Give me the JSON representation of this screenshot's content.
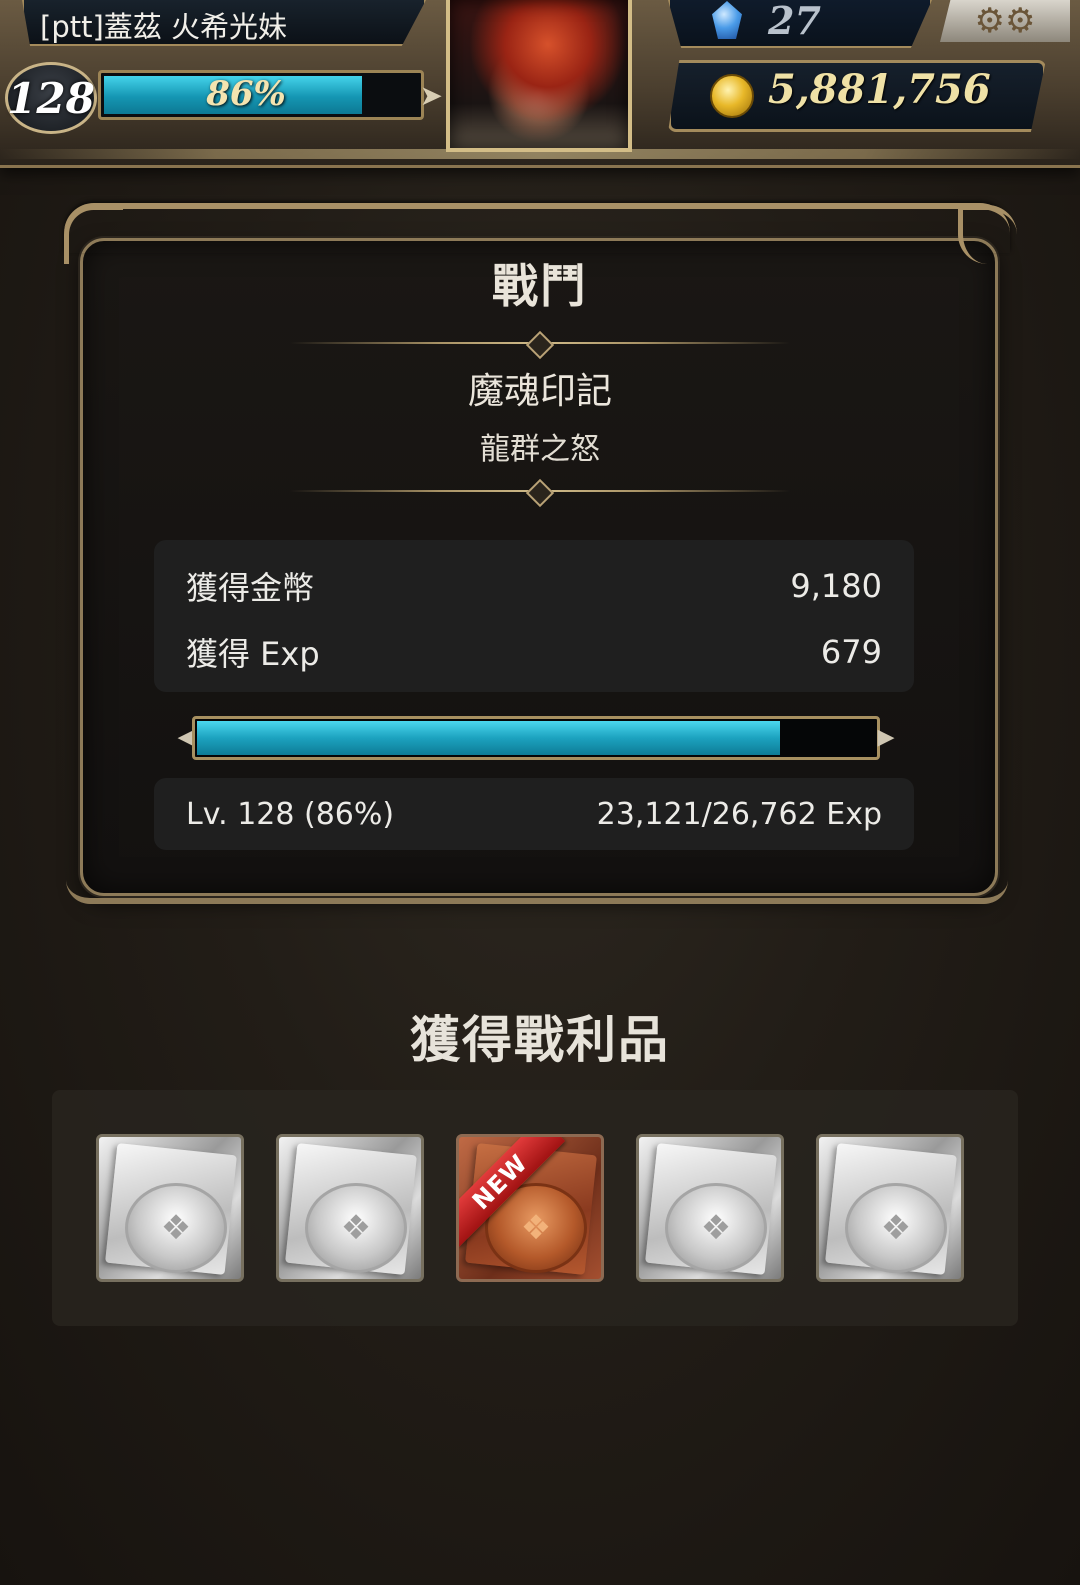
{
  "header": {
    "player_name": "[ptt]蓋茲 火希光妹",
    "level": "128",
    "xp_percent_label": "86%",
    "xp_progress": 0.86,
    "gems": "27",
    "gold": "5,881,756",
    "settings_icon": "gear-icon",
    "gem_icon": "crystal-icon",
    "gold_icon": "coin-icon"
  },
  "battle": {
    "title": "戰鬥",
    "stage_name": "魔魂印記",
    "stage_subtitle": "龍群之怒",
    "rewards": [
      {
        "label": "獲得金幣",
        "value": "9,180"
      },
      {
        "label": "獲得 Exp",
        "value": "679"
      }
    ],
    "xp_progress": 0.86,
    "level_label": "Lv. 128 (86%)",
    "exp_label": "23,121/26,762 Exp"
  },
  "loot": {
    "title": "獲得戰利品",
    "new_label": "NEW",
    "items": [
      {
        "variant": "silver",
        "is_new": false
      },
      {
        "variant": "silver",
        "is_new": false
      },
      {
        "variant": "bronze",
        "is_new": true
      },
      {
        "variant": "silver",
        "is_new": false
      },
      {
        "variant": "silver",
        "is_new": false
      }
    ]
  },
  "colors": {
    "xp_bar": "#1ca2bf",
    "gold_text": "#efe1a6",
    "frame_gold": "#a89066",
    "new_ribbon": "#c81f1f"
  }
}
